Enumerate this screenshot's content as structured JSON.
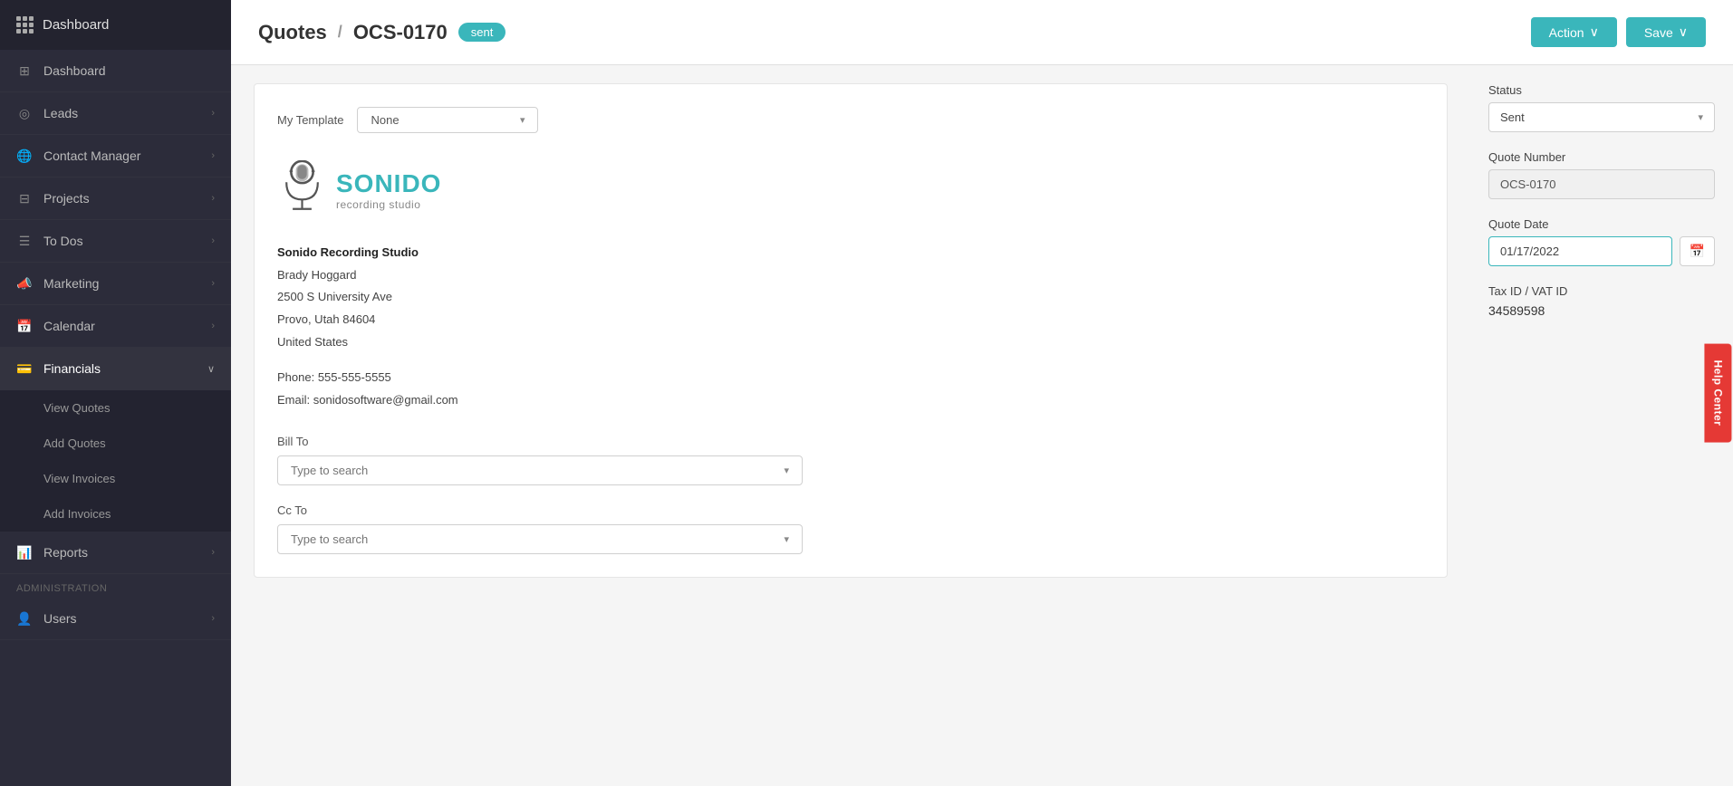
{
  "sidebar": {
    "app_title": "Dashboard",
    "items": [
      {
        "id": "dashboard",
        "label": "Dashboard",
        "icon": "grid",
        "has_chevron": false
      },
      {
        "id": "leads",
        "label": "Leads",
        "icon": "circle-dot",
        "has_chevron": true
      },
      {
        "id": "contact-manager",
        "label": "Contact Manager",
        "icon": "globe-circle",
        "has_chevron": true
      },
      {
        "id": "projects",
        "label": "Projects",
        "icon": "table-cells",
        "has_chevron": true
      },
      {
        "id": "todos",
        "label": "To Dos",
        "icon": "list",
        "has_chevron": true
      },
      {
        "id": "marketing",
        "label": "Marketing",
        "icon": "megaphone",
        "has_chevron": true
      },
      {
        "id": "calendar",
        "label": "Calendar",
        "icon": "calendar",
        "has_chevron": true
      },
      {
        "id": "financials",
        "label": "Financials",
        "icon": "wallet",
        "has_chevron": true,
        "active": true
      }
    ],
    "financials_sub": [
      {
        "id": "view-quotes",
        "label": "View Quotes"
      },
      {
        "id": "add-quotes",
        "label": "Add Quotes"
      },
      {
        "id": "view-invoices",
        "label": "View Invoices"
      },
      {
        "id": "add-invoices",
        "label": "Add Invoices"
      }
    ],
    "bottom_items": [
      {
        "id": "reports",
        "label": "Reports",
        "icon": "bar-chart",
        "has_chevron": true
      }
    ],
    "section_label": "Administration",
    "admin_items": [
      {
        "id": "users",
        "label": "Users",
        "icon": "person",
        "has_chevron": true
      }
    ]
  },
  "header": {
    "breadcrumb_prefix": "Quotes",
    "separator": "/",
    "doc_id": "OCS-0170",
    "status_badge": "sent",
    "action_button": "Action",
    "save_button": "Save"
  },
  "template_row": {
    "label": "My Template",
    "value": "None"
  },
  "company": {
    "name": "Sonido Recording Studio",
    "contact": "Brady Hoggard",
    "address1": "2500 S University Ave",
    "address2": "Provo, Utah 84604",
    "country": "United States",
    "phone_label": "Phone:",
    "phone": "555-555-5555",
    "email_label": "Email:",
    "email": "sonidosoftware@gmail.com",
    "logo_name": "SONIDO",
    "logo_sub": "recording studio"
  },
  "bill_to": {
    "label": "Bill To",
    "placeholder": "Type to search"
  },
  "cc_to": {
    "label": "Cc To",
    "placeholder": "Type to search"
  },
  "right_panel": {
    "status_label": "Status",
    "status_value": "Sent",
    "quote_number_label": "Quote Number",
    "quote_number_value": "OCS-0170",
    "quote_date_label": "Quote Date",
    "quote_date_value": "01/17/2022",
    "tax_label": "Tax ID / VAT ID",
    "tax_value": "34589598"
  },
  "help_center": {
    "label": "Help Center"
  }
}
